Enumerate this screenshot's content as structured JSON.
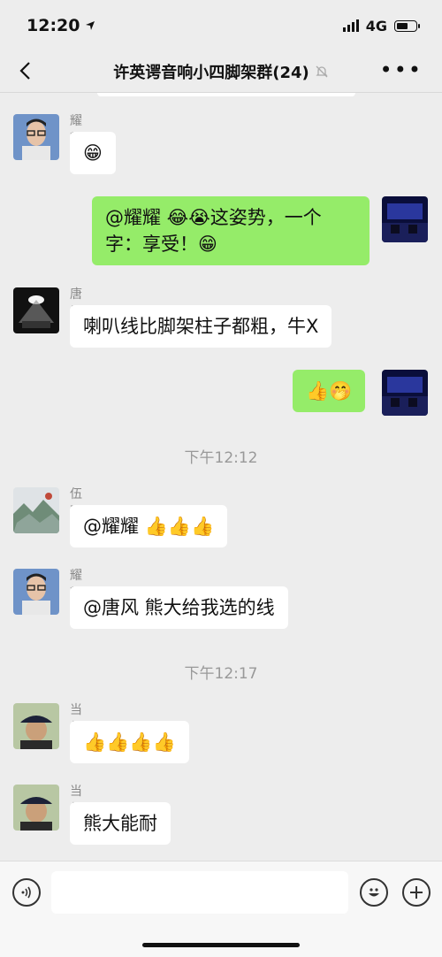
{
  "status": {
    "time": "12:20",
    "network": "4G"
  },
  "nav": {
    "title": "许英谔音响小四脚架群(24)"
  },
  "messages": [
    {
      "sender": "耀耀",
      "text": "😁"
    },
    {
      "text": "@耀耀 😂😭这姿势，一个",
      "text2": "字：享受！😁"
    },
    {
      "sender": "唐风",
      "text": "喇叭线比脚架柱子都粗，牛X"
    },
    {
      "text": "👍🤭"
    },
    {
      "sender": "伍更生",
      "text": "@耀耀 👍👍👍"
    },
    {
      "sender": "耀耀",
      "text": "@唐风 熊大给我选的线"
    },
    {
      "sender": "当然",
      "text": "👍👍👍👍"
    },
    {
      "sender": "当然",
      "text": "熊大能耐"
    }
  ],
  "times": [
    "下午12:12",
    "下午12:17"
  ],
  "icons": {
    "back": "chevron-left-icon",
    "mute": "bell-muted-icon",
    "more": "more-icon",
    "voice": "voice-icon",
    "emoji": "emoji-icon",
    "add": "plus-icon"
  }
}
